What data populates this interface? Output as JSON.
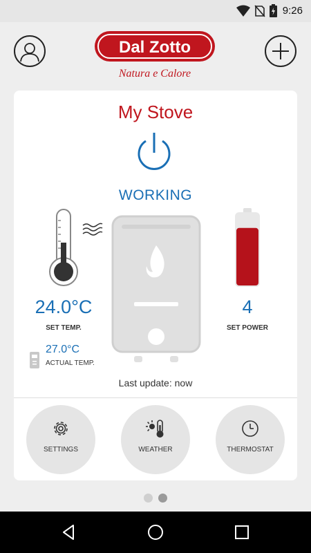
{
  "status_bar": {
    "time": "9:26"
  },
  "brand": {
    "name": "Dal Zotto",
    "tagline": "Natura e Calore",
    "color": "#c0161e"
  },
  "stove": {
    "name": "My Stove",
    "state": "WORKING",
    "set_temp": "24.0°C",
    "set_temp_label": "SET TEMP.",
    "actual_temp": "27.0°C",
    "actual_temp_label": "ACTUAL TEMP.",
    "set_power": "4",
    "set_power_label": "SET POWER",
    "power_level": 0.8,
    "last_update": "Last update: now"
  },
  "actions": [
    {
      "label": "SETTINGS",
      "icon": "gear-icon"
    },
    {
      "label": "WEATHER",
      "icon": "weather-icon"
    },
    {
      "label": "THERMOSTAT",
      "icon": "clock-icon"
    }
  ],
  "pager": {
    "pages": 2,
    "active": 2
  },
  "colors": {
    "accent_blue": "#1a6fb5",
    "power_fill": "#b5121b"
  }
}
